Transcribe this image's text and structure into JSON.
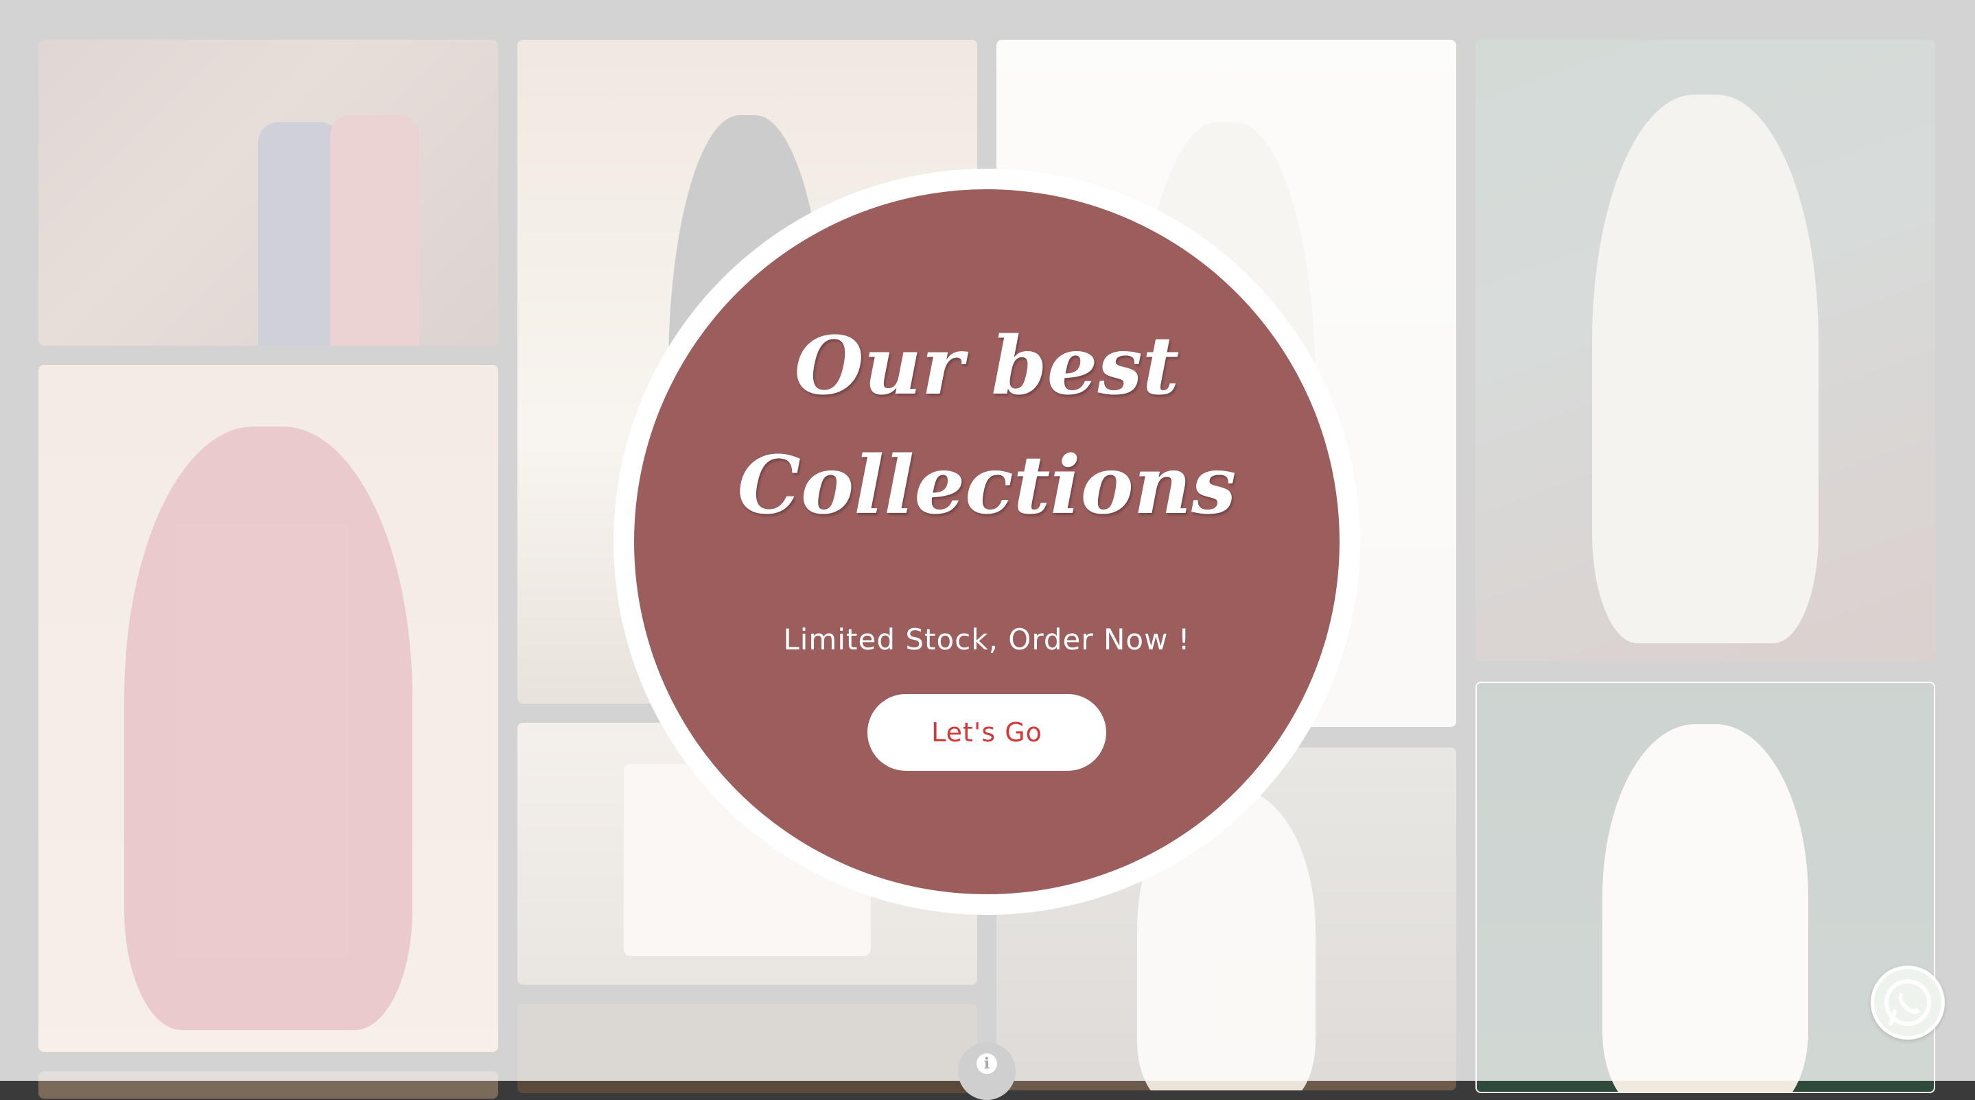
{
  "popup": {
    "title_line1": "Our best",
    "title_line2": "Collections",
    "subtitle": "Limited Stock, Order Now !",
    "cta_label": "Let's Go"
  },
  "floating": {
    "info_glyph": "i",
    "info_icon": "info-icon",
    "whatsapp_icon": "whatsapp-icon"
  },
  "colors": {
    "popup_fill": "#9c5d5d",
    "cta_text": "#d43a3a",
    "overlay": "rgba(255,255,255,0.78)"
  }
}
